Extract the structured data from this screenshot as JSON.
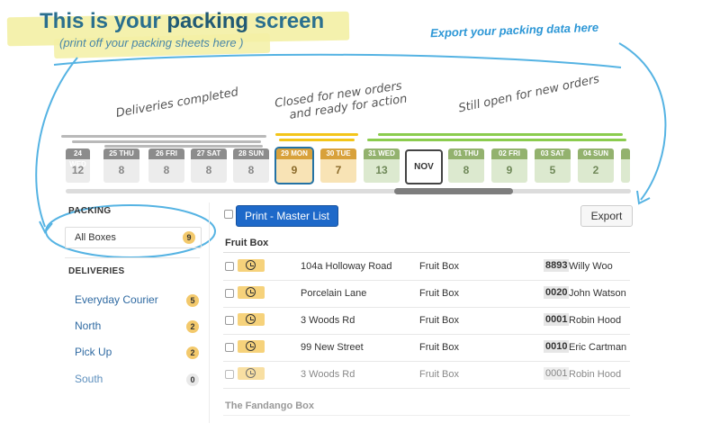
{
  "annotations": {
    "title_pre": "This is your ",
    "title_bold": "packing",
    "title_post": " screen",
    "subtitle": "(print off your packing sheets here )",
    "export_note": "Export your packing data here",
    "deliveries_completed": "Deliveries completed",
    "closed_line1": "Closed for new orders",
    "closed_line2": "and ready for action",
    "still_open": "Still open for new orders"
  },
  "dates": [
    {
      "label": "24 WED",
      "count": "12",
      "status": "completed"
    },
    {
      "label": "25 THU",
      "count": "8",
      "status": "completed"
    },
    {
      "label": "26 FRI",
      "count": "8",
      "status": "completed"
    },
    {
      "label": "27 SAT",
      "count": "8",
      "status": "completed"
    },
    {
      "label": "28 SUN",
      "count": "8",
      "status": "completed"
    },
    {
      "label": "29 MON",
      "count": "9",
      "status": "closed"
    },
    {
      "label": "30 TUE",
      "count": "7",
      "status": "closed"
    },
    {
      "label": "31 WED",
      "count": "13",
      "status": "open"
    },
    {
      "label": "01 THU",
      "count": "8",
      "status": "open"
    },
    {
      "label": "02 FRI",
      "count": "9",
      "status": "open"
    },
    {
      "label": "03 SAT",
      "count": "5",
      "status": "open"
    },
    {
      "label": "04 SUN",
      "count": "2",
      "status": "open"
    }
  ],
  "month_marker": "NOV",
  "sidebar": {
    "packing_header": "PACKING",
    "all_boxes_label": "All Boxes",
    "all_boxes_count": "9",
    "deliveries_header": "DELIVERIES",
    "deliveries": [
      {
        "label": "Everyday Courier",
        "count": "5"
      },
      {
        "label": "North",
        "count": "2"
      },
      {
        "label": "Pick Up",
        "count": "2"
      },
      {
        "label": "South",
        "count": "0"
      }
    ]
  },
  "toolbar": {
    "print_label": "Print - Master List",
    "export_label": "Export"
  },
  "groups": [
    {
      "title": "Fruit Box",
      "rows": [
        {
          "address": "104a Holloway Road",
          "box": "Fruit Box",
          "code": "8893",
          "name": "Willy Woo"
        },
        {
          "address": "Porcelain Lane",
          "box": "Fruit Box",
          "code": "0020",
          "name": "John Watson"
        },
        {
          "address": "3 Woods Rd",
          "box": "Fruit Box",
          "code": "0001",
          "name": "Robin Hood"
        },
        {
          "address": "99 New Street",
          "box": "Fruit Box",
          "code": "0010",
          "name": "Eric Cartman"
        },
        {
          "address": "3 Woods Rd",
          "box": "Fruit Box",
          "code": "0001",
          "name": "Robin Hood"
        }
      ]
    },
    {
      "title": "The Fandango Box",
      "rows": []
    }
  ],
  "colors": {
    "accent_blue": "#1e69c9",
    "completed_gray": "#8c8c8c",
    "closed_yellow": "#d8a13b",
    "open_green": "#93b26e",
    "annotation_blue": "#2d97d6"
  }
}
